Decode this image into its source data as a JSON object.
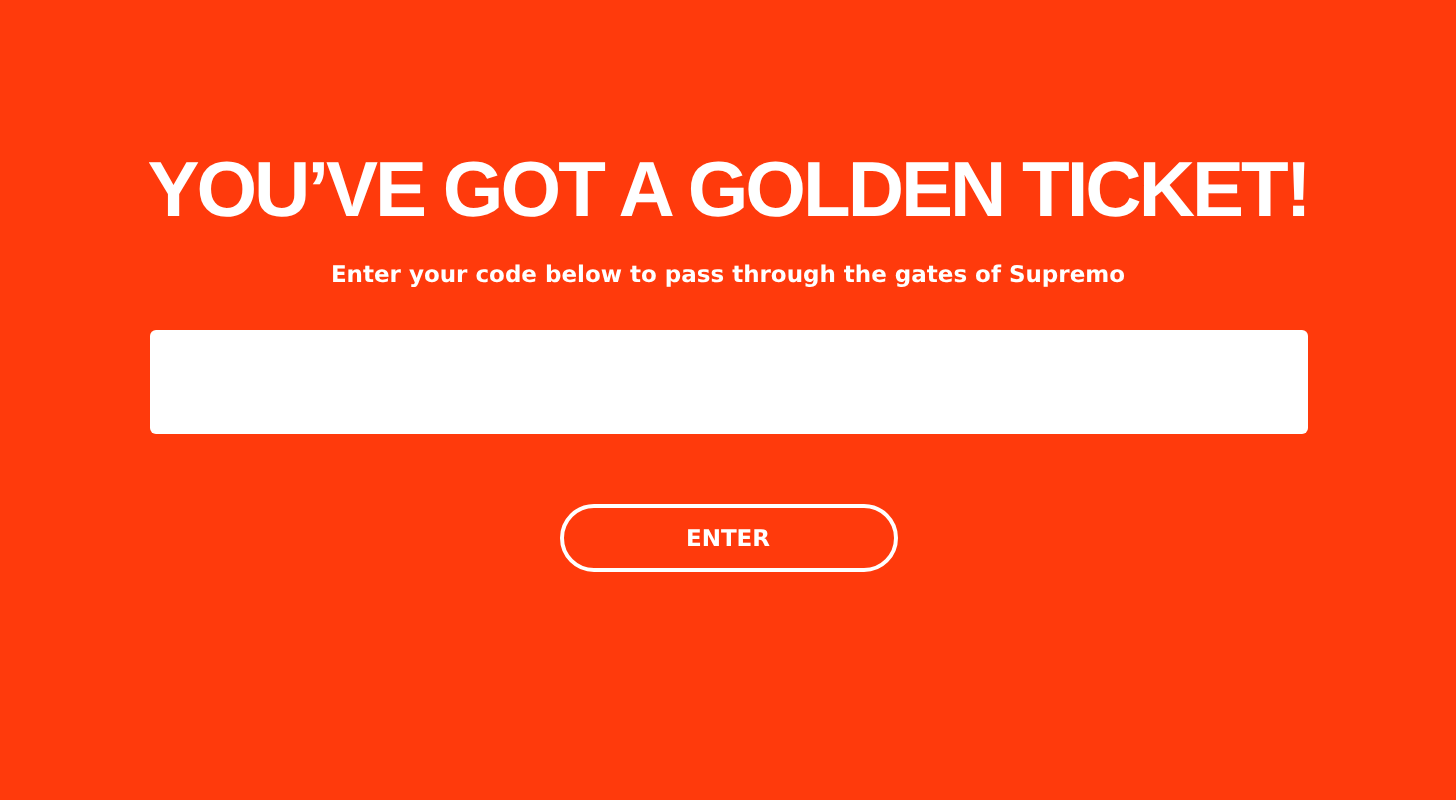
{
  "heading": "YOU’VE GOT A GOLDEN TICKET!",
  "subheading": "Enter your code below to pass through the gates of Supremo",
  "button": {
    "label": "ENTER"
  }
}
